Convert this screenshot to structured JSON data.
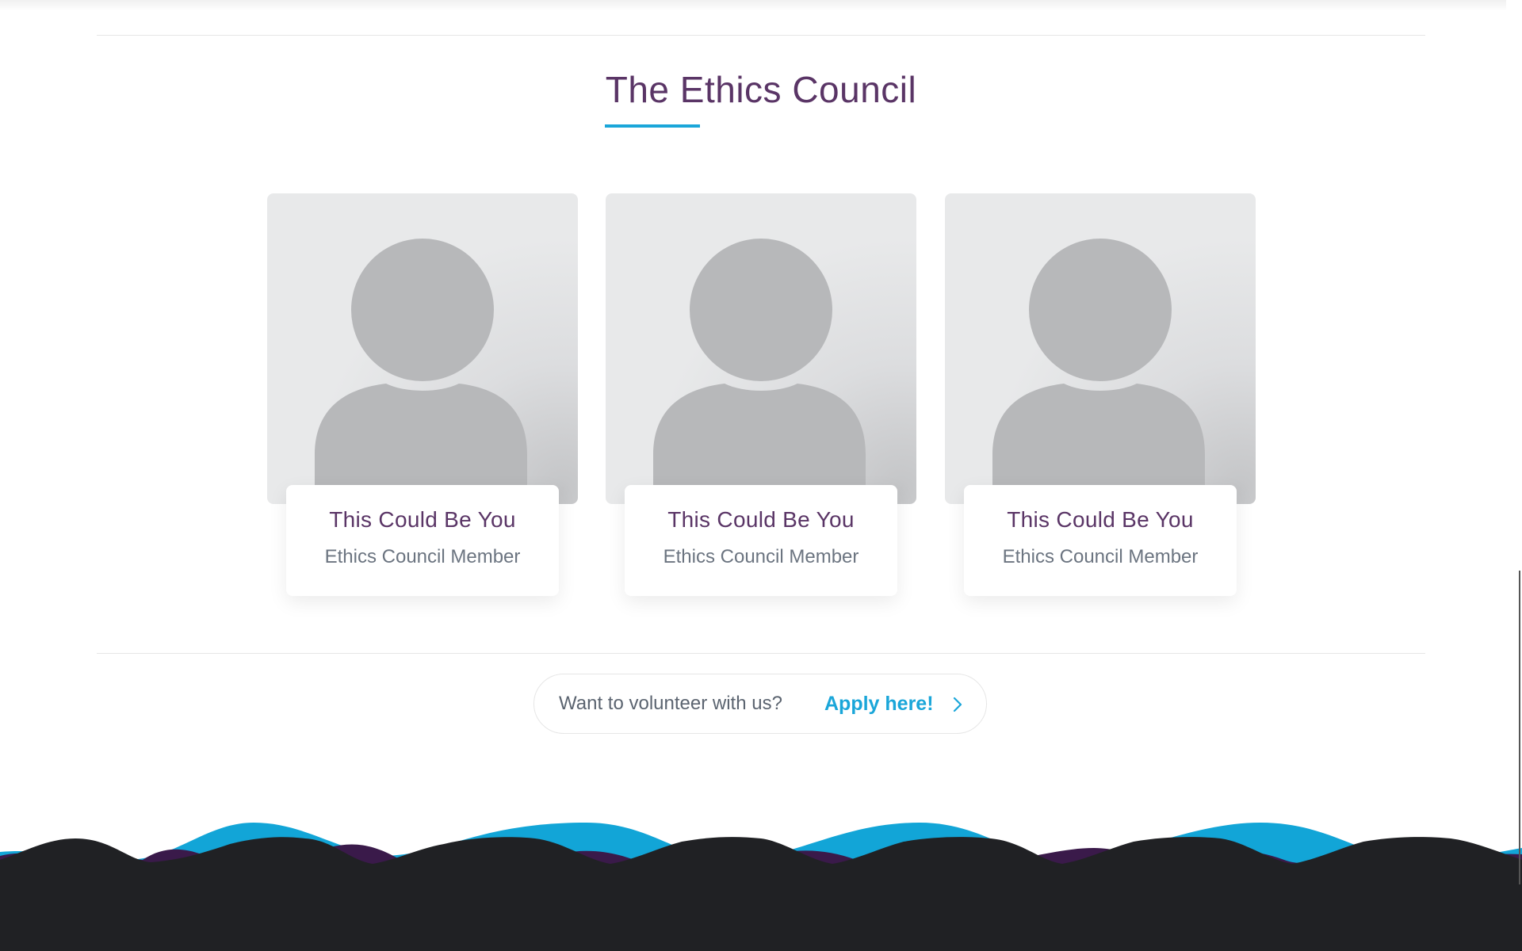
{
  "section": {
    "title": "The Ethics Council"
  },
  "members": [
    {
      "name": "This Could Be You",
      "role": "Ethics Council Member"
    },
    {
      "name": "This Could Be You",
      "role": "Ethics Council Member"
    },
    {
      "name": "This Could Be You",
      "role": "Ethics Council Member"
    }
  ],
  "cta": {
    "text": "Want to volunteer with us?",
    "link_label": "Apply here!",
    "arrow_icon": "chevron-right-icon"
  },
  "colors": {
    "title": "#5a3566",
    "accent": "#1aa6d9",
    "footer_dark": "#202124",
    "footer_purple": "#3a1a4a"
  }
}
